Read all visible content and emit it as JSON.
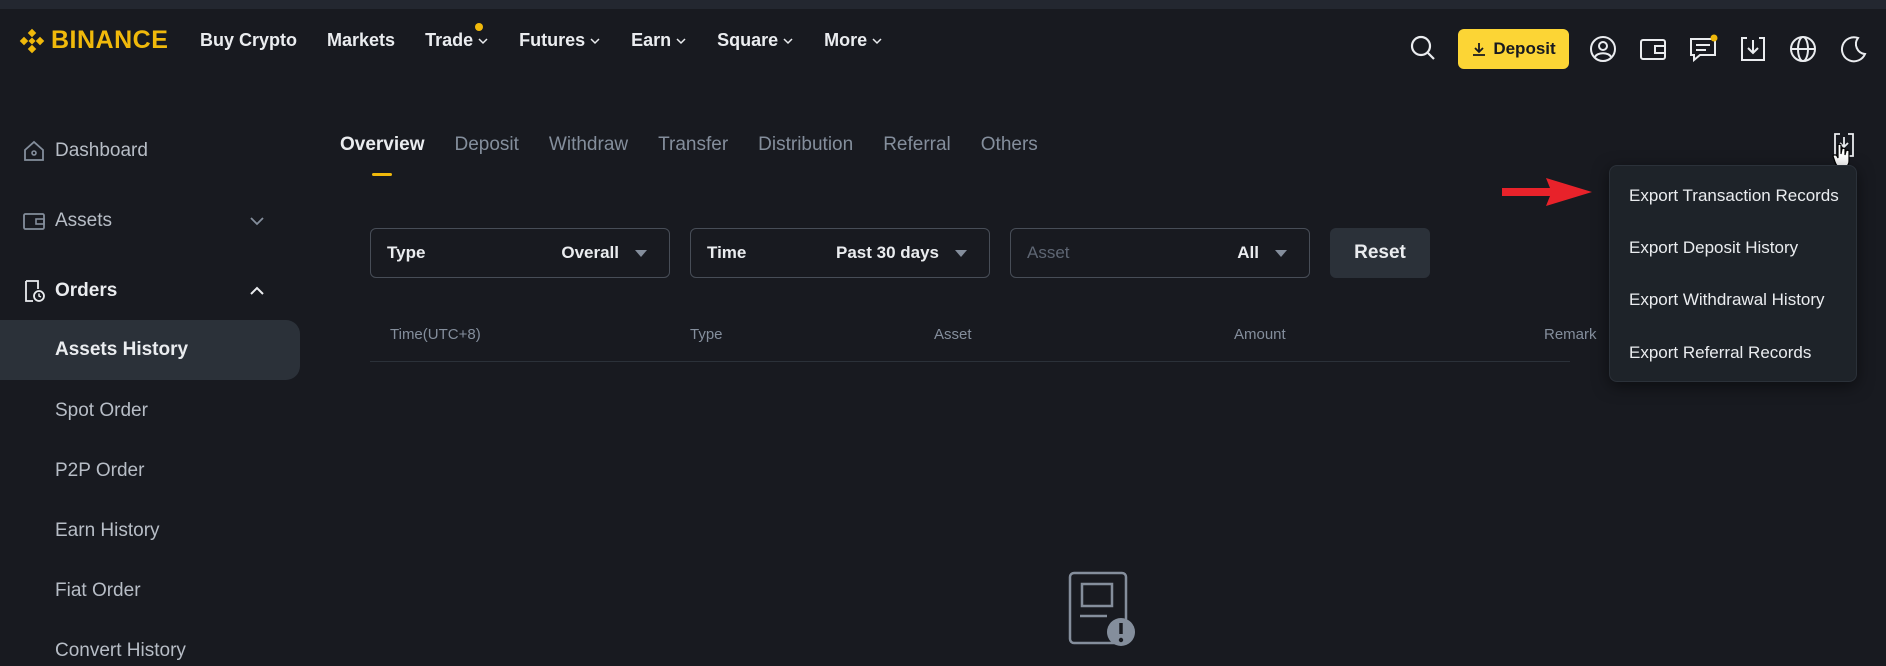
{
  "brand": {
    "name": "BINANCE",
    "color": "#f0b90b"
  },
  "nav": {
    "items": [
      {
        "label": "Buy Crypto",
        "has_chevron": false
      },
      {
        "label": "Markets",
        "has_chevron": false
      },
      {
        "label": "Trade",
        "has_chevron": true,
        "has_dot": true
      },
      {
        "label": "Futures",
        "has_chevron": true
      },
      {
        "label": "Earn",
        "has_chevron": true
      },
      {
        "label": "Square",
        "has_chevron": true
      },
      {
        "label": "More",
        "has_chevron": true
      }
    ],
    "deposit_label": "Deposit",
    "icons": [
      "search-icon",
      "download-icon",
      "user-icon",
      "wallet-icon",
      "message-icon",
      "app-download-icon",
      "globe-icon",
      "moon-icon"
    ]
  },
  "sidebar": {
    "items": [
      {
        "label": "Dashboard",
        "icon": "home-icon"
      },
      {
        "label": "Assets",
        "icon": "wallet-icon",
        "chevron": "down"
      },
      {
        "label": "Orders",
        "icon": "orders-icon",
        "chevron": "up"
      },
      {
        "label": "Assets History"
      },
      {
        "label": "Spot Order"
      },
      {
        "label": "P2P Order"
      },
      {
        "label": "Earn History"
      },
      {
        "label": "Fiat Order"
      },
      {
        "label": "Convert History"
      }
    ],
    "active": "Assets History"
  },
  "tabs": {
    "items": [
      "Overview",
      "Deposit",
      "Withdraw",
      "Transfer",
      "Distribution",
      "Referral",
      "Others"
    ],
    "active": "Overview"
  },
  "filters": {
    "type": {
      "label": "Type",
      "value": "Overall"
    },
    "time": {
      "label": "Time",
      "value": "Past 30 days"
    },
    "asset": {
      "label": "Asset",
      "value": "All"
    },
    "reset_label": "Reset"
  },
  "table": {
    "columns": [
      "Time(UTC+8)",
      "Type",
      "Asset",
      "Amount",
      "Remark"
    ]
  },
  "export_menu": {
    "items": [
      "Export Transaction Records",
      "Export Deposit History",
      "Export Withdrawal History",
      "Export Referral Records"
    ]
  },
  "colors": {
    "accent": "#fcd535",
    "background": "#181a20",
    "arrow": "#e8222a"
  }
}
